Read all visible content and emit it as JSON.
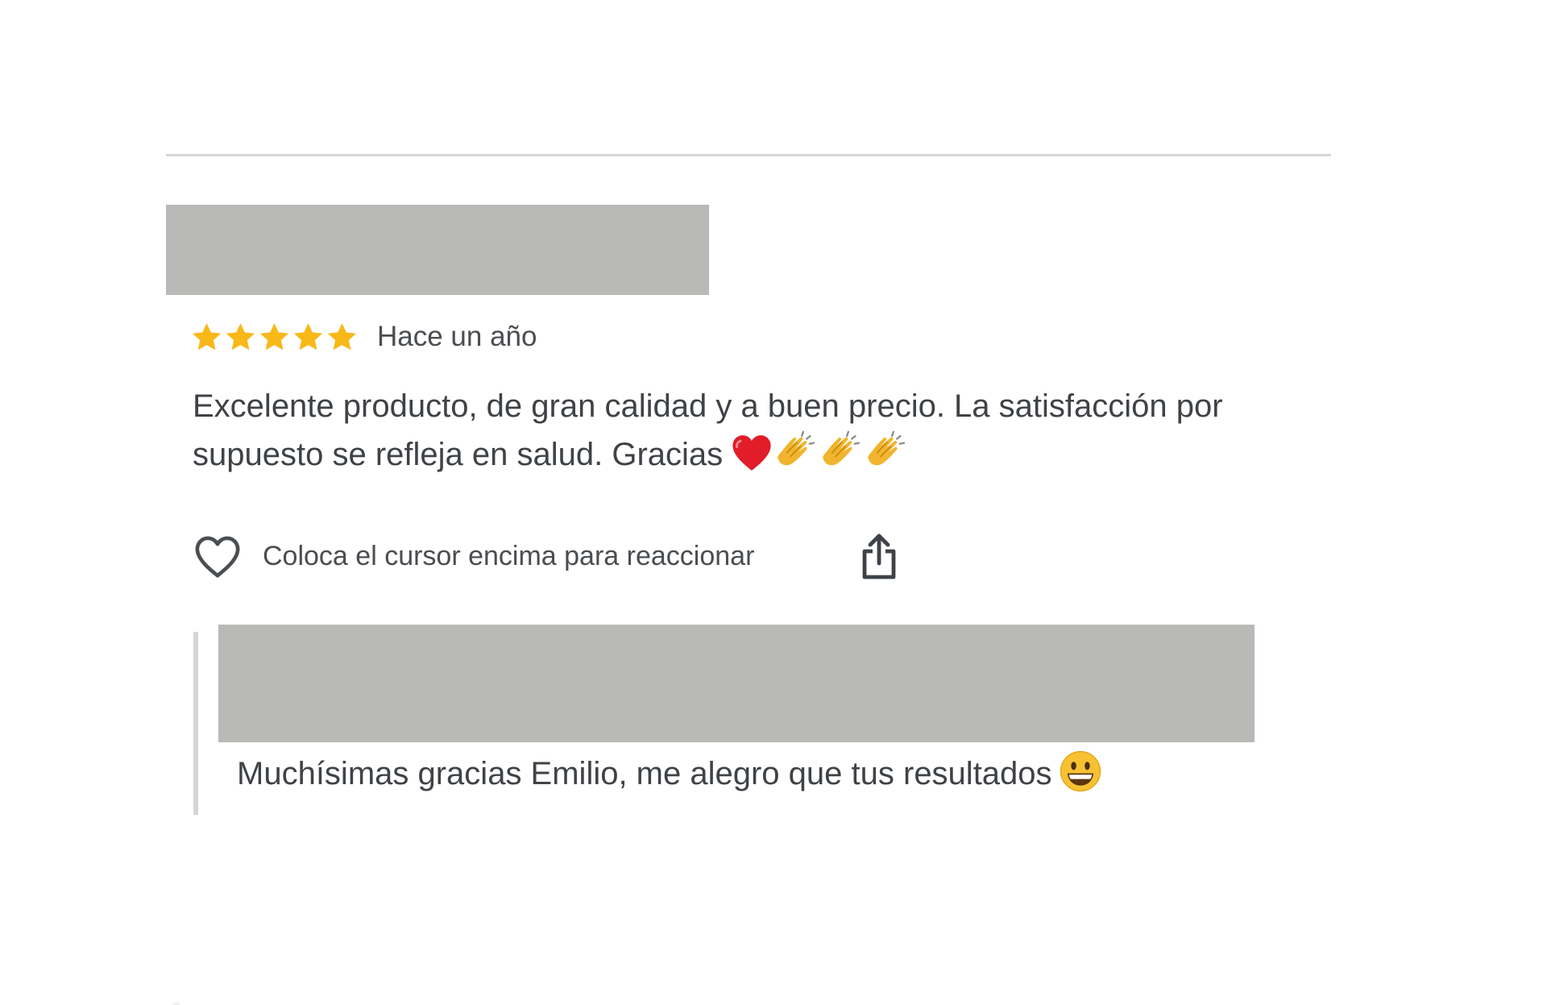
{
  "review": {
    "reviewer_name_redacted": true,
    "rating": 5,
    "rating_max": 5,
    "date": "Hace un año",
    "text": "Excelente producto, de gran calidad y a buen precio. La satisfacción por supuesto se refleja en salud. Gracias",
    "trailing_emojis": [
      "red-heart-emoji",
      "clapping-hands-emoji",
      "clapping-hands-emoji",
      "clapping-hands-emoji"
    ]
  },
  "actions": {
    "react_label": "Coloca el cursor encima para reaccionar",
    "react_icon": "heart-outline-icon",
    "share_icon": "share-icon"
  },
  "reply": {
    "author_redacted": true,
    "text": "Muchísimas gracias Emilio, me alegro que tus resultados",
    "trailing_emoji": "grinning-face-emoji"
  },
  "colors": {
    "star": "#f8b818",
    "text": "#3f4246",
    "redaction": "#b9b9b8",
    "divider": "#d6d6d6",
    "heart_emoji": "#e11d2a"
  }
}
